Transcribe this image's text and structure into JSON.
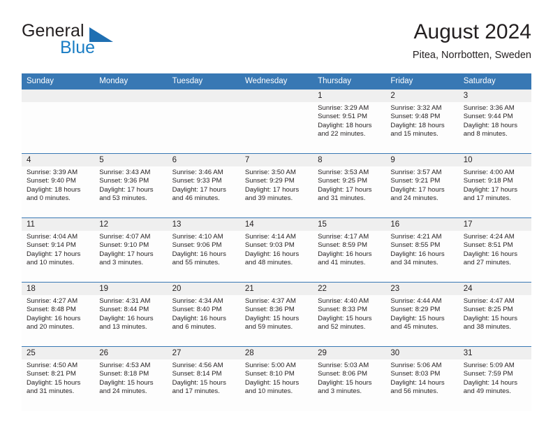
{
  "logo": {
    "text_general": "General",
    "text_blue": "Blue",
    "accent_color": "#1f6fb2"
  },
  "header": {
    "title": "August 2024",
    "subtitle": "Pitea, Norrbotten, Sweden"
  },
  "theme": {
    "header_bg": "#3878b4",
    "daynum_bg": "#efefef",
    "text": "#231f20"
  },
  "weekdays": [
    "Sunday",
    "Monday",
    "Tuesday",
    "Wednesday",
    "Thursday",
    "Friday",
    "Saturday"
  ],
  "weeks": [
    [
      {
        "empty": true
      },
      {
        "empty": true
      },
      {
        "empty": true
      },
      {
        "empty": true
      },
      {
        "day": "1",
        "sunrise": "Sunrise: 3:29 AM",
        "sunset": "Sunset: 9:51 PM",
        "daylight1": "Daylight: 18 hours",
        "daylight2": "and 22 minutes."
      },
      {
        "day": "2",
        "sunrise": "Sunrise: 3:32 AM",
        "sunset": "Sunset: 9:48 PM",
        "daylight1": "Daylight: 18 hours",
        "daylight2": "and 15 minutes."
      },
      {
        "day": "3",
        "sunrise": "Sunrise: 3:36 AM",
        "sunset": "Sunset: 9:44 PM",
        "daylight1": "Daylight: 18 hours",
        "daylight2": "and 8 minutes."
      }
    ],
    [
      {
        "day": "4",
        "sunrise": "Sunrise: 3:39 AM",
        "sunset": "Sunset: 9:40 PM",
        "daylight1": "Daylight: 18 hours",
        "daylight2": "and 0 minutes."
      },
      {
        "day": "5",
        "sunrise": "Sunrise: 3:43 AM",
        "sunset": "Sunset: 9:36 PM",
        "daylight1": "Daylight: 17 hours",
        "daylight2": "and 53 minutes."
      },
      {
        "day": "6",
        "sunrise": "Sunrise: 3:46 AM",
        "sunset": "Sunset: 9:33 PM",
        "daylight1": "Daylight: 17 hours",
        "daylight2": "and 46 minutes."
      },
      {
        "day": "7",
        "sunrise": "Sunrise: 3:50 AM",
        "sunset": "Sunset: 9:29 PM",
        "daylight1": "Daylight: 17 hours",
        "daylight2": "and 39 minutes."
      },
      {
        "day": "8",
        "sunrise": "Sunrise: 3:53 AM",
        "sunset": "Sunset: 9:25 PM",
        "daylight1": "Daylight: 17 hours",
        "daylight2": "and 31 minutes."
      },
      {
        "day": "9",
        "sunrise": "Sunrise: 3:57 AM",
        "sunset": "Sunset: 9:21 PM",
        "daylight1": "Daylight: 17 hours",
        "daylight2": "and 24 minutes."
      },
      {
        "day": "10",
        "sunrise": "Sunrise: 4:00 AM",
        "sunset": "Sunset: 9:18 PM",
        "daylight1": "Daylight: 17 hours",
        "daylight2": "and 17 minutes."
      }
    ],
    [
      {
        "day": "11",
        "sunrise": "Sunrise: 4:04 AM",
        "sunset": "Sunset: 9:14 PM",
        "daylight1": "Daylight: 17 hours",
        "daylight2": "and 10 minutes."
      },
      {
        "day": "12",
        "sunrise": "Sunrise: 4:07 AM",
        "sunset": "Sunset: 9:10 PM",
        "daylight1": "Daylight: 17 hours",
        "daylight2": "and 3 minutes."
      },
      {
        "day": "13",
        "sunrise": "Sunrise: 4:10 AM",
        "sunset": "Sunset: 9:06 PM",
        "daylight1": "Daylight: 16 hours",
        "daylight2": "and 55 minutes."
      },
      {
        "day": "14",
        "sunrise": "Sunrise: 4:14 AM",
        "sunset": "Sunset: 9:03 PM",
        "daylight1": "Daylight: 16 hours",
        "daylight2": "and 48 minutes."
      },
      {
        "day": "15",
        "sunrise": "Sunrise: 4:17 AM",
        "sunset": "Sunset: 8:59 PM",
        "daylight1": "Daylight: 16 hours",
        "daylight2": "and 41 minutes."
      },
      {
        "day": "16",
        "sunrise": "Sunrise: 4:21 AM",
        "sunset": "Sunset: 8:55 PM",
        "daylight1": "Daylight: 16 hours",
        "daylight2": "and 34 minutes."
      },
      {
        "day": "17",
        "sunrise": "Sunrise: 4:24 AM",
        "sunset": "Sunset: 8:51 PM",
        "daylight1": "Daylight: 16 hours",
        "daylight2": "and 27 minutes."
      }
    ],
    [
      {
        "day": "18",
        "sunrise": "Sunrise: 4:27 AM",
        "sunset": "Sunset: 8:48 PM",
        "daylight1": "Daylight: 16 hours",
        "daylight2": "and 20 minutes."
      },
      {
        "day": "19",
        "sunrise": "Sunrise: 4:31 AM",
        "sunset": "Sunset: 8:44 PM",
        "daylight1": "Daylight: 16 hours",
        "daylight2": "and 13 minutes."
      },
      {
        "day": "20",
        "sunrise": "Sunrise: 4:34 AM",
        "sunset": "Sunset: 8:40 PM",
        "daylight1": "Daylight: 16 hours",
        "daylight2": "and 6 minutes."
      },
      {
        "day": "21",
        "sunrise": "Sunrise: 4:37 AM",
        "sunset": "Sunset: 8:36 PM",
        "daylight1": "Daylight: 15 hours",
        "daylight2": "and 59 minutes."
      },
      {
        "day": "22",
        "sunrise": "Sunrise: 4:40 AM",
        "sunset": "Sunset: 8:33 PM",
        "daylight1": "Daylight: 15 hours",
        "daylight2": "and 52 minutes."
      },
      {
        "day": "23",
        "sunrise": "Sunrise: 4:44 AM",
        "sunset": "Sunset: 8:29 PM",
        "daylight1": "Daylight: 15 hours",
        "daylight2": "and 45 minutes."
      },
      {
        "day": "24",
        "sunrise": "Sunrise: 4:47 AM",
        "sunset": "Sunset: 8:25 PM",
        "daylight1": "Daylight: 15 hours",
        "daylight2": "and 38 minutes."
      }
    ],
    [
      {
        "day": "25",
        "sunrise": "Sunrise: 4:50 AM",
        "sunset": "Sunset: 8:21 PM",
        "daylight1": "Daylight: 15 hours",
        "daylight2": "and 31 minutes."
      },
      {
        "day": "26",
        "sunrise": "Sunrise: 4:53 AM",
        "sunset": "Sunset: 8:18 PM",
        "daylight1": "Daylight: 15 hours",
        "daylight2": "and 24 minutes."
      },
      {
        "day": "27",
        "sunrise": "Sunrise: 4:56 AM",
        "sunset": "Sunset: 8:14 PM",
        "daylight1": "Daylight: 15 hours",
        "daylight2": "and 17 minutes."
      },
      {
        "day": "28",
        "sunrise": "Sunrise: 5:00 AM",
        "sunset": "Sunset: 8:10 PM",
        "daylight1": "Daylight: 15 hours",
        "daylight2": "and 10 minutes."
      },
      {
        "day": "29",
        "sunrise": "Sunrise: 5:03 AM",
        "sunset": "Sunset: 8:06 PM",
        "daylight1": "Daylight: 15 hours",
        "daylight2": "and 3 minutes."
      },
      {
        "day": "30",
        "sunrise": "Sunrise: 5:06 AM",
        "sunset": "Sunset: 8:03 PM",
        "daylight1": "Daylight: 14 hours",
        "daylight2": "and 56 minutes."
      },
      {
        "day": "31",
        "sunrise": "Sunrise: 5:09 AM",
        "sunset": "Sunset: 7:59 PM",
        "daylight1": "Daylight: 14 hours",
        "daylight2": "and 49 minutes."
      }
    ]
  ]
}
